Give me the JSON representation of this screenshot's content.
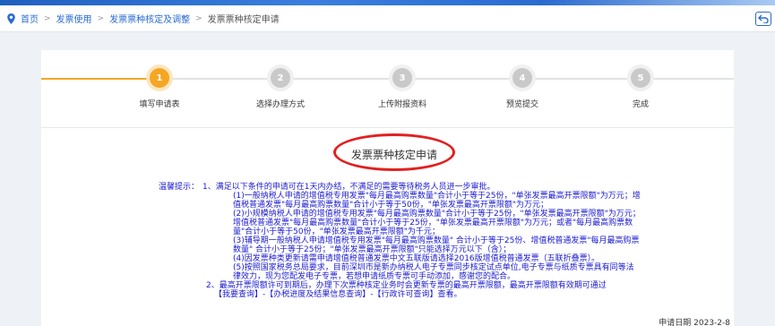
{
  "breadcrumb": {
    "items": [
      "首页",
      "发票使用",
      "发票票种核定及调整"
    ],
    "current": "发票票种核定申请"
  },
  "steps": [
    {
      "number": "1",
      "label": "填写申请表",
      "active": true
    },
    {
      "number": "2",
      "label": "选择办理方式",
      "active": false
    },
    {
      "number": "3",
      "label": "上传附报资料",
      "active": false
    },
    {
      "number": "4",
      "label": "预览提交",
      "active": false
    },
    {
      "number": "5",
      "label": "完成",
      "active": false
    }
  ],
  "form": {
    "title": "发票票种核定申请"
  },
  "notice": {
    "label": "温馨提示：",
    "lines": [
      "1、满足以下条件的申请可在1天内办结，不满足的需要等待税务人员进一步审批。",
      "(1)一般纳税人申请的增值税专用发票\"每月最高购票数量\"合计小于等于25份，\"单张发票最高开票限额\"为万元；增",
      "值税普通发票\"每月最高购票数量\"合计小于等于50份，\"单张发票最高开票限额\"为万元；",
      "(2)小规模纳税人申请的增值税专用发票\"每月最高购票数量\"合计小于等于25份，\"单张发票最高开票限额\"为万元；",
      "增值税普通发票\"每月最高购票数量\"合计小于等于25份，\"单张发票最高开票限额\"为万元；或者\"每月最高购票数",
      "量\"合计小于等于50份，\"单张发票最高开票限额\"为千元；",
      "(3)辅导期一般纳税人申请增值税专用发票\"每月最高购票数量\" 合计小于等于25份、增值税普通发票\"每月最高购票",
      "数量\" 合计小于等于25份；\"单张发票最高开票限额\"只能选择万元以下（含）；",
      "(4)因发票种类更新请需申请增值税普通发票中文五联版请选择2016版增值税普通发票（五联折叠票）。",
      "(5)按照国家税务总局要求，目前深圳市是新办纳税人电子专票同步核定试点单位,电子专票与纸质专票具有同等法",
      "律效力，现为您配发电子专票，若想申请纸质专票可手动添加，感谢您的配合。",
      "2、最高开票限额许可到期后，办理下次票种核定业务时会更新专票的最高开票限额，最高开票限额有效期可通过",
      "【我要查询】-【办税进度及结果信息查询】-【行政许可查询】查看。"
    ]
  },
  "apply_date": "申请日期 2023-2-8",
  "colors": {
    "accent": "#f5a623",
    "link": "#2a6bd0",
    "notice_text": "#1a1ad0",
    "highlight_oval": "#e22020"
  }
}
